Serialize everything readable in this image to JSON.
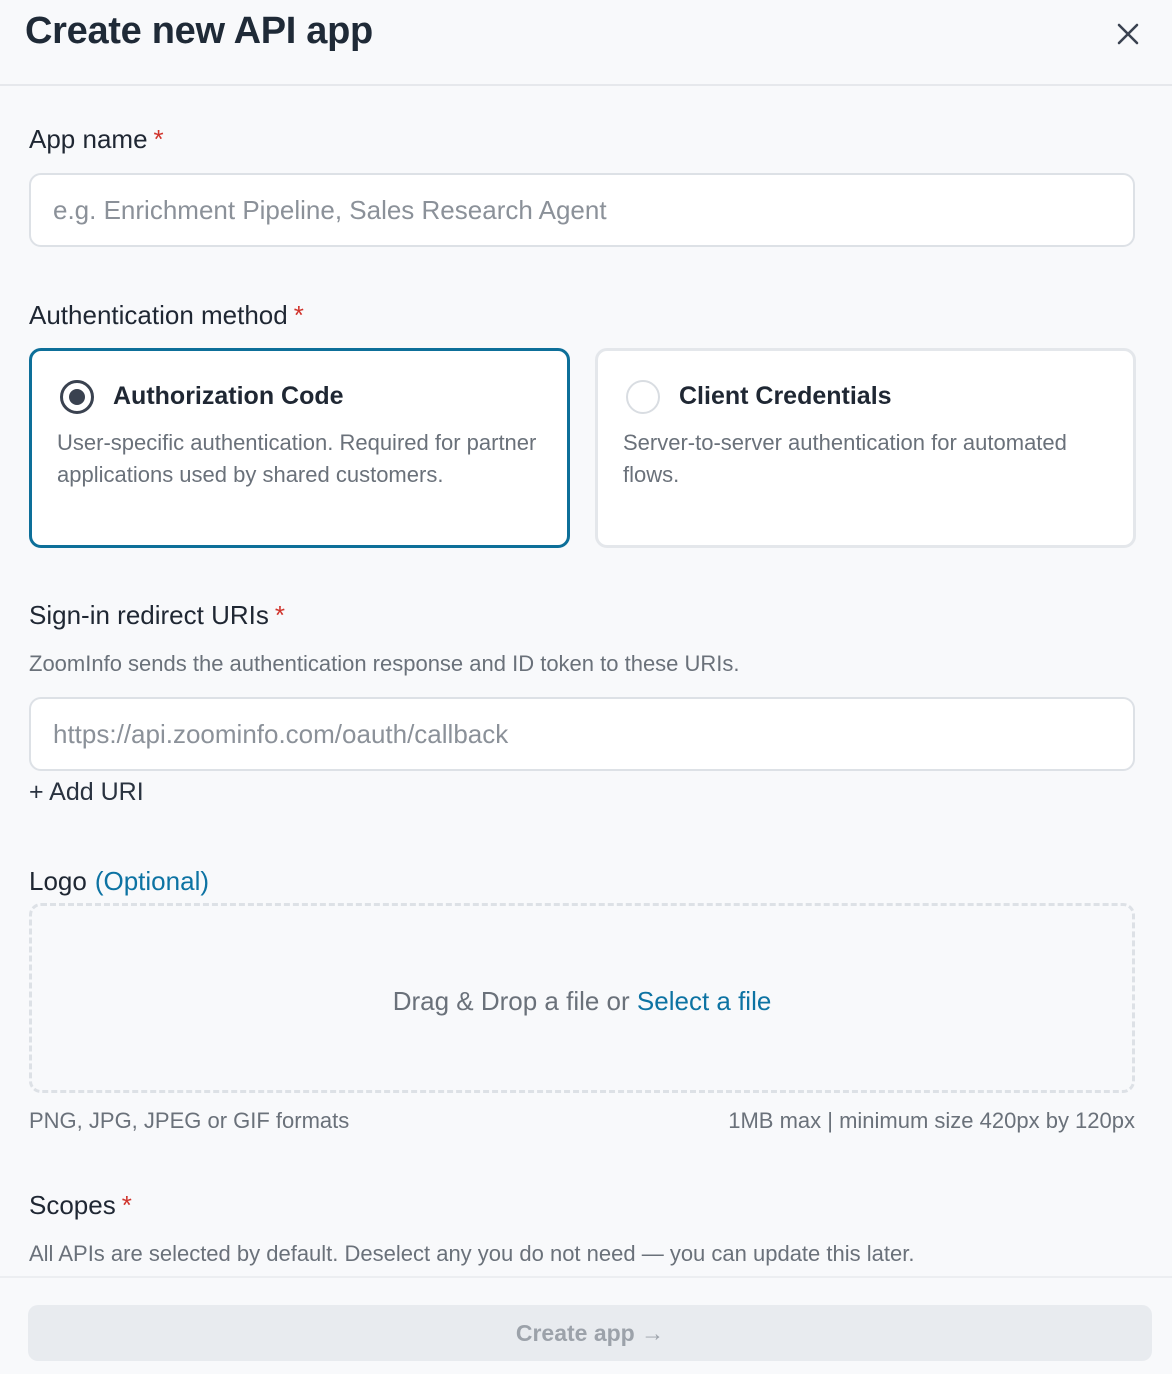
{
  "header": {
    "title": "Create new API app",
    "close_icon": "close-icon"
  },
  "app_name": {
    "label": "App name",
    "required_mark": "*",
    "value": "",
    "placeholder": "e.g. Enrichment Pipeline, Sales Research Agent"
  },
  "auth_method": {
    "label": "Authentication method",
    "required_mark": "*",
    "options": [
      {
        "title": "Authorization Code",
        "description": "User-specific authentication. Required for partner applications used by shared customers.",
        "selected": true
      },
      {
        "title": "Client Credentials",
        "description": "Server-to-server authentication for automated flows.",
        "selected": false
      }
    ],
    "colors": {
      "selected_border": "#0d6f99"
    }
  },
  "redirect_uris": {
    "label": "Sign-in redirect URIs",
    "required_mark": "*",
    "help": "ZoomInfo sends the authentication response and ID token to these URIs.",
    "value": "",
    "placeholder": "https://api.zoominfo.com/oauth/callback",
    "add_label": "+ Add URI"
  },
  "logo": {
    "label": "Logo",
    "optional_label": "(Optional)",
    "drop_text": "Drag & Drop a file or",
    "select_link": "Select a file",
    "formats": "PNG, JPG, JPEG or GIF formats",
    "size_hint": "1MB max | minimum size 420px by 120px"
  },
  "scopes": {
    "label": "Scopes",
    "required_mark": "*",
    "help": "All APIs are selected by default. Deselect any you do not need — you can update this later."
  },
  "footer": {
    "create_label": "Create app →"
  },
  "colors": {
    "accent": "#0d73a3",
    "required": "#d0342c"
  }
}
